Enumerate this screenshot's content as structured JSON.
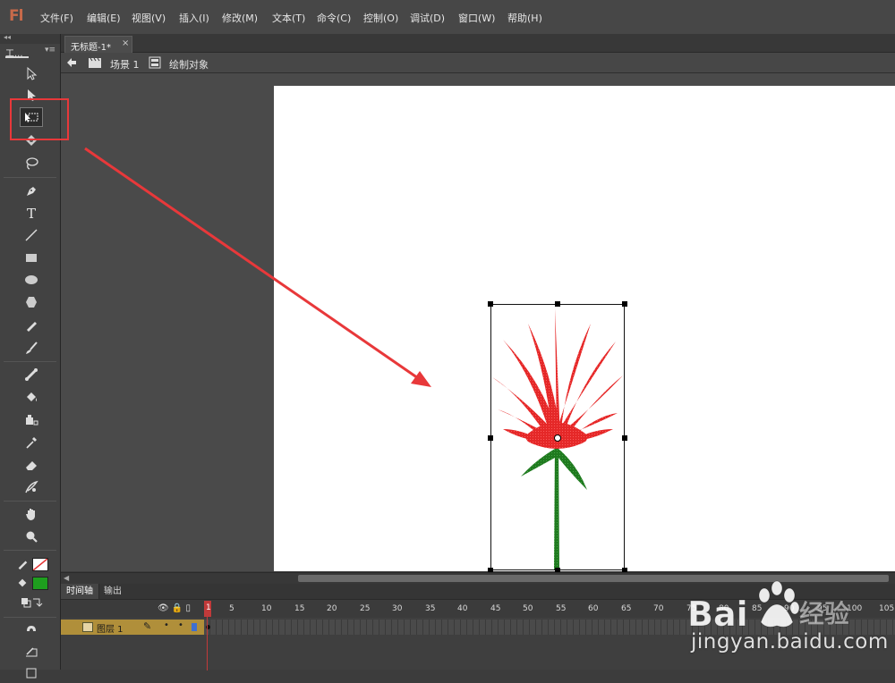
{
  "app": {
    "logo": "Fl",
    "menu": [
      "文件(F)",
      "编辑(E)",
      "视图(V)",
      "插入(I)",
      "修改(M)",
      "文本(T)",
      "命令(C)",
      "控制(O)",
      "调试(D)",
      "窗口(W)",
      "帮助(H)"
    ]
  },
  "tools_panel": {
    "tab_label": "工...",
    "menu_glyph": "▾≡",
    "selected_tool": "free-transform",
    "stroke_color": "#ffffff",
    "fill_color": "#1e9e1e"
  },
  "document": {
    "tab_title": "无标题-1*",
    "tab_close": "×"
  },
  "scene_bar": {
    "scene_label": "场景 1",
    "object_label": "绘制对象"
  },
  "timeline": {
    "tabs": [
      "时间轴",
      "输出"
    ],
    "header_icons": "👁 🔒 ▯",
    "frame_numbers": [
      "5",
      "10",
      "15",
      "20",
      "25",
      "30",
      "35",
      "40",
      "45",
      "50",
      "55",
      "60",
      "65",
      "70",
      "75",
      "80",
      "85",
      "90",
      "95",
      "100",
      "105"
    ],
    "current_frame": "1",
    "layer": {
      "name": "图层 1",
      "pencil": "✎",
      "dot": "•"
    }
  },
  "colors": {
    "highlight": "#e8383a",
    "flower_red": "#e52828",
    "stem_green": "#1f7a1f",
    "layer_bg": "#b08f3a"
  },
  "watermark": {
    "brand": "Bai",
    "brand_cn": "经验",
    "url": "jingyan.baidu.com"
  }
}
